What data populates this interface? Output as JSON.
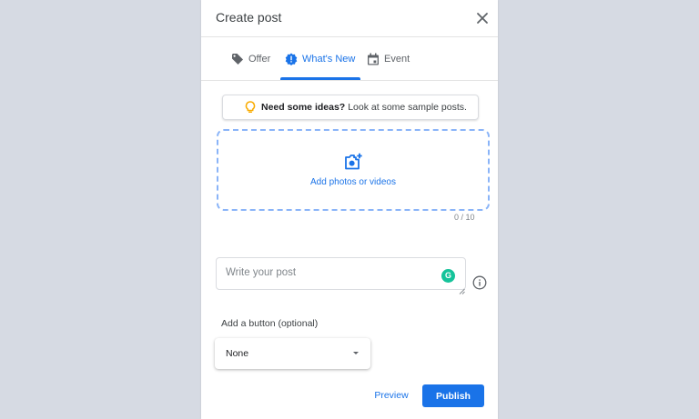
{
  "dialog": {
    "title": "Create post",
    "close_icon": "close-icon"
  },
  "tabs": [
    {
      "label": "Offer",
      "icon": "tag-icon",
      "active": false
    },
    {
      "label": "What's New",
      "icon": "alert-badge-icon",
      "active": true
    },
    {
      "label": "Event",
      "icon": "calendar-icon",
      "active": false
    }
  ],
  "ideas": {
    "bold": "Need some ideas?",
    "text": "Look at some sample posts.",
    "icon": "lightbulb-icon"
  },
  "media": {
    "label": "Add photos or videos",
    "icon": "add-photo-icon",
    "counter": "0 / 10"
  },
  "post": {
    "placeholder": "Write your post",
    "value": "",
    "grammarly": "G"
  },
  "button_section": {
    "label": "Add a button (optional)",
    "selected": "None"
  },
  "actions": {
    "preview": "Preview",
    "publish": "Publish"
  },
  "colors": {
    "accent": "#1a73e8",
    "grammarly": "#15c39a",
    "bulb": "#f9ab00",
    "background": "#d6dae3"
  }
}
